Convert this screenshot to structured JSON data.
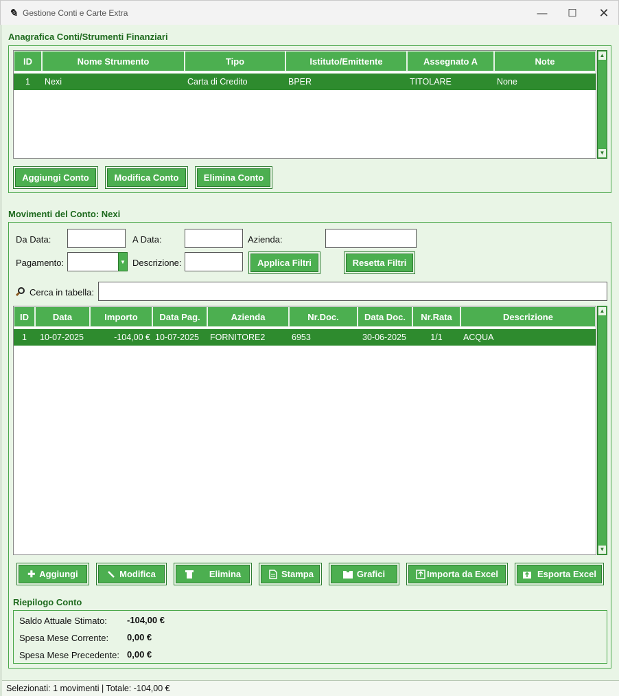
{
  "window": {
    "title": "Gestione Conti e Carte Extra",
    "min": "—",
    "max": "☐",
    "close": "✕"
  },
  "accounts": {
    "section_title": "Anagrafica Conti/Strumenti Finanziari",
    "columns": [
      "ID",
      "Nome Strumento",
      "Tipo",
      "Istituto/Emittente",
      "Assegnato A",
      "Note"
    ],
    "rows": [
      {
        "id": "1",
        "nome": "Nexi",
        "tipo": "Carta di Credito",
        "istituto": "BPER",
        "assegnato": "TITOLARE",
        "note": "None"
      }
    ],
    "buttons": {
      "add": "Aggiungi Conto",
      "edit": "Modifica Conto",
      "delete": "Elimina Conto"
    }
  },
  "movements": {
    "section_title": "Movimenti del Conto: Nexi",
    "filters": {
      "from_label": "Da Data:",
      "from_value": "",
      "to_label": "A Data:",
      "to_value": "",
      "company_label": "Azienda:",
      "company_value": "",
      "payment_label": "Pagamento:",
      "payment_value": "",
      "desc_label": "Descrizione:",
      "desc_value": "",
      "apply": "Applica Filtri",
      "reset": "Resetta Filtri"
    },
    "search": {
      "label": "Cerca in tabella:",
      "value": ""
    },
    "columns": [
      "ID",
      "Data",
      "Importo",
      "Data Pag.",
      "Azienda",
      "Nr.Doc.",
      "Data Doc.",
      "Nr.Rata",
      "Descrizione"
    ],
    "rows": [
      {
        "id": "1",
        "data": "10-07-2025",
        "importo": "-104,00 €",
        "data_pag": "10-07-2025",
        "azienda": "FORNITORE2",
        "nr_doc": "6953",
        "data_doc": "30-06-2025",
        "nr_rata": "1/1",
        "descrizione": "ACQUA"
      }
    ],
    "buttons": {
      "add": "Aggiungi",
      "edit": "Modifica",
      "delete": "Elimina",
      "print": "Stampa",
      "charts": "Grafici",
      "import": "Importa da Excel",
      "export": "Esporta Excel"
    }
  },
  "summary": {
    "title": "Riepilogo Conto",
    "balance_label": "Saldo Attuale Stimato:",
    "balance_value": "-104,00 €",
    "current_label": "Spesa Mese Corrente:",
    "current_value": "0,00 €",
    "previous_label": "Spesa Mese Precedente:",
    "previous_value": "0,00 €"
  },
  "status": "Selezionati: 1 movimenti | Totale: -104,00 €",
  "colors": {
    "accent": "#4caf50",
    "selected_row": "#2e8b2e",
    "background": "#e9f5e6",
    "title_text": "#1e6a1e"
  },
  "icons": {
    "app": "feather-icon",
    "add": "plus-icon",
    "edit": "pencil-icon",
    "delete": "trash-icon",
    "print": "document-icon",
    "charts": "chart-icon",
    "import": "import-icon",
    "export": "export-icon",
    "search": "magnifier-icon"
  }
}
